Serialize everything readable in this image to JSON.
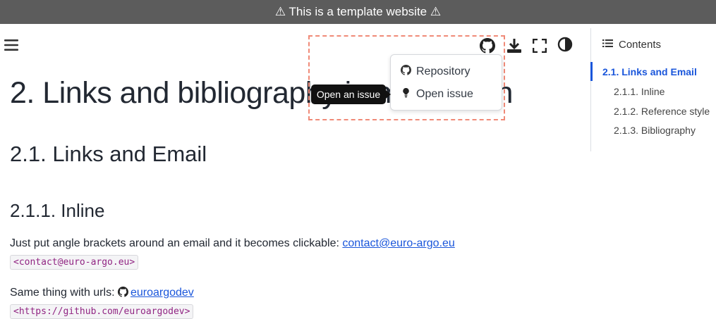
{
  "banner": {
    "text": "⚠ This is a template website ⚠"
  },
  "header": {
    "menu_icon": "menu-icon",
    "icons": [
      "github-icon",
      "download-icon",
      "fullscreen-icon",
      "theme-toggle-icon"
    ]
  },
  "dropdown": {
    "items": [
      {
        "label": "Repository",
        "icon": "github-icon"
      },
      {
        "label": "Open issue",
        "icon": "lightbulb-icon"
      }
    ]
  },
  "tooltip": {
    "text": "Open an issue"
  },
  "article": {
    "h1": "2. Links and bibliography in markdown",
    "h2": "2.1. Links and Email",
    "h3": "2.1.1. Inline",
    "p1_text": "Just put angle brackets around an email and it becomes clickable: ",
    "p1_link": "contact@euro-argo.eu",
    "code1": "<contact@euro-argo.eu>",
    "p2_text": "Same thing with urls: ",
    "p2_link": "euroargodev",
    "code2": "<https://github.com/euroargodev>"
  },
  "toc": {
    "title": "Contents",
    "items": [
      {
        "label": "2.1. Links and Email",
        "active": true
      },
      {
        "label": "2.1.1. Inline"
      },
      {
        "label": "2.1.2. Reference style"
      },
      {
        "label": "2.1.3. Bibliography"
      }
    ]
  },
  "colors": {
    "link": "#1a56db",
    "highlight": "#f08a78",
    "banner": "#5c5c5c"
  }
}
